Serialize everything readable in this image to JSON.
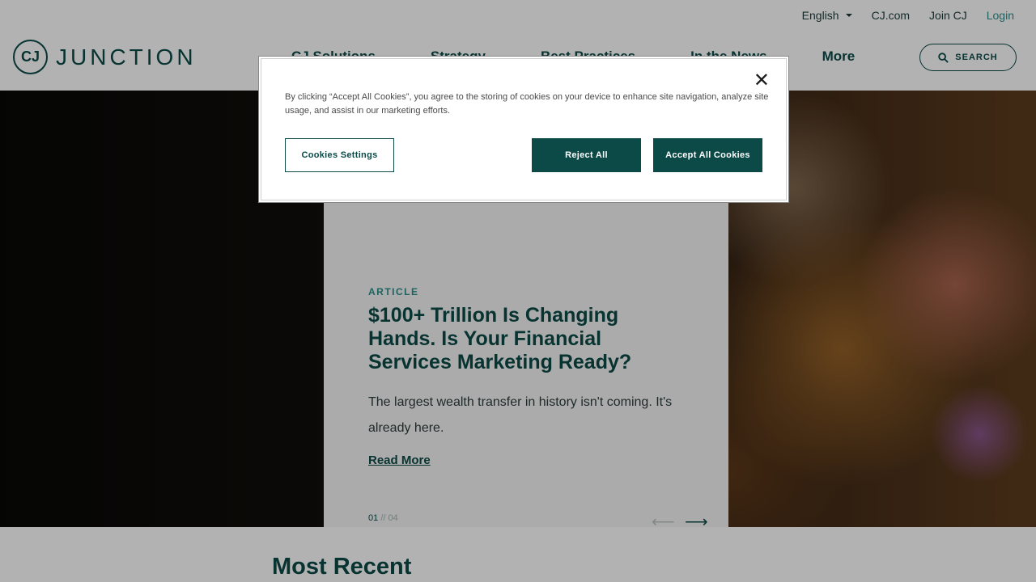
{
  "utility": {
    "language": "English",
    "cj_link": "CJ.com",
    "join_link": "Join CJ",
    "login_link": "Login"
  },
  "header": {
    "logo_mark": "CJ",
    "logo_text": "JUNCTION",
    "nav": [
      "CJ Solutions",
      "Strategy",
      "Best Practices",
      "In the News",
      "More"
    ],
    "search_label": "SEARCH"
  },
  "hero": {
    "kicker": "ARTICLE",
    "title": "$100+ Trillion Is Changing Hands. Is Your Financial Services Marketing Ready?",
    "description": "The largest wealth transfer in history isn't coming. It's already here.",
    "read_more": "Read More",
    "pager_current": "01",
    "pager_separator": "//",
    "pager_total": "04"
  },
  "recent": {
    "heading": "Most Recent"
  },
  "cookie_dialog": {
    "text": "By clicking “Accept All Cookies”, you agree to the storing of cookies on your device to enhance site navigation, analyze site usage, and assist in our marketing efforts.",
    "settings_label": "Cookies Settings",
    "reject_label": "Reject All",
    "accept_label": "Accept All Cookies",
    "close_glyph": "✕"
  },
  "colors": {
    "brand": "#0b4a47",
    "accent": "#2b8f8a"
  }
}
